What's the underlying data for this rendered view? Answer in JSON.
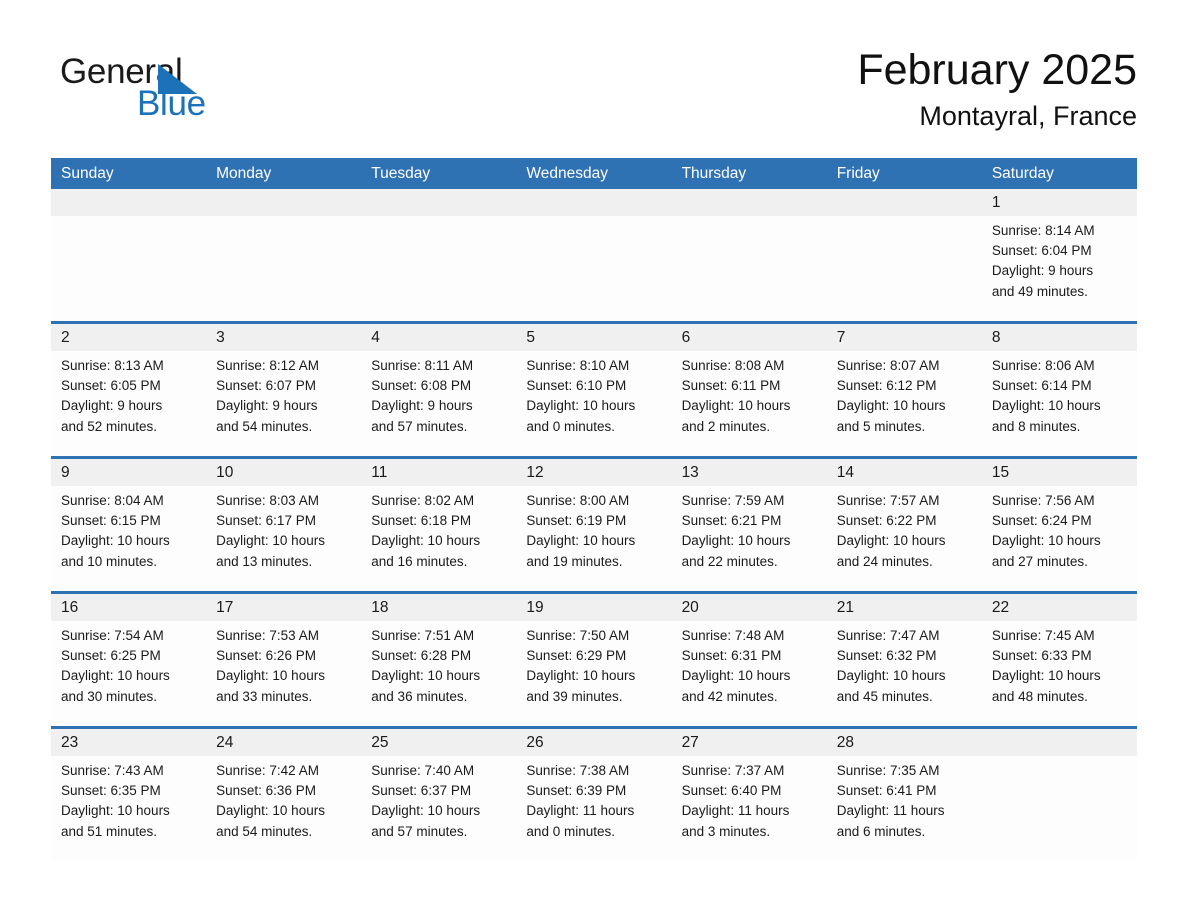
{
  "brand": {
    "name_part1": "General",
    "name_part2": "Blue",
    "flag_icon": "triangle-flag-icon",
    "accent_color": "#1b72b8"
  },
  "header": {
    "month_title": "February 2025",
    "location": "Montayral, France"
  },
  "theme": {
    "header_bar_color": "#2f72b4",
    "day_number_band_color": "#f0f0f0",
    "cell_background": "#fdfdfd",
    "text_color": "#1a1a1a"
  },
  "weekdays": [
    "Sunday",
    "Monday",
    "Tuesday",
    "Wednesday",
    "Thursday",
    "Friday",
    "Saturday"
  ],
  "weeks": [
    {
      "days": [
        {
          "number": "",
          "lines": []
        },
        {
          "number": "",
          "lines": []
        },
        {
          "number": "",
          "lines": []
        },
        {
          "number": "",
          "lines": []
        },
        {
          "number": "",
          "lines": []
        },
        {
          "number": "",
          "lines": []
        },
        {
          "number": "1",
          "lines": [
            "Sunrise: 8:14 AM",
            "Sunset: 6:04 PM",
            "Daylight: 9 hours",
            "and 49 minutes."
          ]
        }
      ]
    },
    {
      "days": [
        {
          "number": "2",
          "lines": [
            "Sunrise: 8:13 AM",
            "Sunset: 6:05 PM",
            "Daylight: 9 hours",
            "and 52 minutes."
          ]
        },
        {
          "number": "3",
          "lines": [
            "Sunrise: 8:12 AM",
            "Sunset: 6:07 PM",
            "Daylight: 9 hours",
            "and 54 minutes."
          ]
        },
        {
          "number": "4",
          "lines": [
            "Sunrise: 8:11 AM",
            "Sunset: 6:08 PM",
            "Daylight: 9 hours",
            "and 57 minutes."
          ]
        },
        {
          "number": "5",
          "lines": [
            "Sunrise: 8:10 AM",
            "Sunset: 6:10 PM",
            "Daylight: 10 hours",
            "and 0 minutes."
          ]
        },
        {
          "number": "6",
          "lines": [
            "Sunrise: 8:08 AM",
            "Sunset: 6:11 PM",
            "Daylight: 10 hours",
            "and 2 minutes."
          ]
        },
        {
          "number": "7",
          "lines": [
            "Sunrise: 8:07 AM",
            "Sunset: 6:12 PM",
            "Daylight: 10 hours",
            "and 5 minutes."
          ]
        },
        {
          "number": "8",
          "lines": [
            "Sunrise: 8:06 AM",
            "Sunset: 6:14 PM",
            "Daylight: 10 hours",
            "and 8 minutes."
          ]
        }
      ]
    },
    {
      "days": [
        {
          "number": "9",
          "lines": [
            "Sunrise: 8:04 AM",
            "Sunset: 6:15 PM",
            "Daylight: 10 hours",
            "and 10 minutes."
          ]
        },
        {
          "number": "10",
          "lines": [
            "Sunrise: 8:03 AM",
            "Sunset: 6:17 PM",
            "Daylight: 10 hours",
            "and 13 minutes."
          ]
        },
        {
          "number": "11",
          "lines": [
            "Sunrise: 8:02 AM",
            "Sunset: 6:18 PM",
            "Daylight: 10 hours",
            "and 16 minutes."
          ]
        },
        {
          "number": "12",
          "lines": [
            "Sunrise: 8:00 AM",
            "Sunset: 6:19 PM",
            "Daylight: 10 hours",
            "and 19 minutes."
          ]
        },
        {
          "number": "13",
          "lines": [
            "Sunrise: 7:59 AM",
            "Sunset: 6:21 PM",
            "Daylight: 10 hours",
            "and 22 minutes."
          ]
        },
        {
          "number": "14",
          "lines": [
            "Sunrise: 7:57 AM",
            "Sunset: 6:22 PM",
            "Daylight: 10 hours",
            "and 24 minutes."
          ]
        },
        {
          "number": "15",
          "lines": [
            "Sunrise: 7:56 AM",
            "Sunset: 6:24 PM",
            "Daylight: 10 hours",
            "and 27 minutes."
          ]
        }
      ]
    },
    {
      "days": [
        {
          "number": "16",
          "lines": [
            "Sunrise: 7:54 AM",
            "Sunset: 6:25 PM",
            "Daylight: 10 hours",
            "and 30 minutes."
          ]
        },
        {
          "number": "17",
          "lines": [
            "Sunrise: 7:53 AM",
            "Sunset: 6:26 PM",
            "Daylight: 10 hours",
            "and 33 minutes."
          ]
        },
        {
          "number": "18",
          "lines": [
            "Sunrise: 7:51 AM",
            "Sunset: 6:28 PM",
            "Daylight: 10 hours",
            "and 36 minutes."
          ]
        },
        {
          "number": "19",
          "lines": [
            "Sunrise: 7:50 AM",
            "Sunset: 6:29 PM",
            "Daylight: 10 hours",
            "and 39 minutes."
          ]
        },
        {
          "number": "20",
          "lines": [
            "Sunrise: 7:48 AM",
            "Sunset: 6:31 PM",
            "Daylight: 10 hours",
            "and 42 minutes."
          ]
        },
        {
          "number": "21",
          "lines": [
            "Sunrise: 7:47 AM",
            "Sunset: 6:32 PM",
            "Daylight: 10 hours",
            "and 45 minutes."
          ]
        },
        {
          "number": "22",
          "lines": [
            "Sunrise: 7:45 AM",
            "Sunset: 6:33 PM",
            "Daylight: 10 hours",
            "and 48 minutes."
          ]
        }
      ]
    },
    {
      "days": [
        {
          "number": "23",
          "lines": [
            "Sunrise: 7:43 AM",
            "Sunset: 6:35 PM",
            "Daylight: 10 hours",
            "and 51 minutes."
          ]
        },
        {
          "number": "24",
          "lines": [
            "Sunrise: 7:42 AM",
            "Sunset: 6:36 PM",
            "Daylight: 10 hours",
            "and 54 minutes."
          ]
        },
        {
          "number": "25",
          "lines": [
            "Sunrise: 7:40 AM",
            "Sunset: 6:37 PM",
            "Daylight: 10 hours",
            "and 57 minutes."
          ]
        },
        {
          "number": "26",
          "lines": [
            "Sunrise: 7:38 AM",
            "Sunset: 6:39 PM",
            "Daylight: 11 hours",
            "and 0 minutes."
          ]
        },
        {
          "number": "27",
          "lines": [
            "Sunrise: 7:37 AM",
            "Sunset: 6:40 PM",
            "Daylight: 11 hours",
            "and 3 minutes."
          ]
        },
        {
          "number": "28",
          "lines": [
            "Sunrise: 7:35 AM",
            "Sunset: 6:41 PM",
            "Daylight: 11 hours",
            "and 6 minutes."
          ]
        },
        {
          "number": "",
          "lines": []
        }
      ]
    }
  ]
}
